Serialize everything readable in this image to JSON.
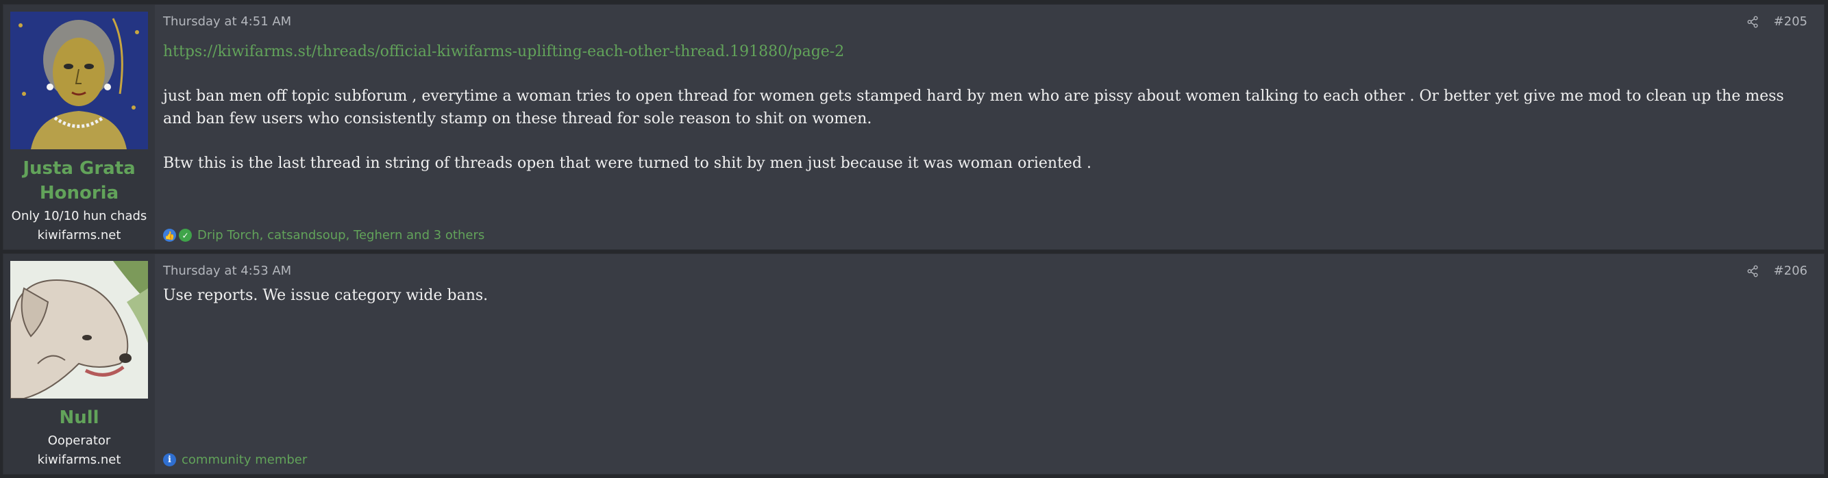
{
  "posts": [
    {
      "author": {
        "name_line1": "Justa Grata",
        "name_line2": "Honoria",
        "title": "Only 10/10 hun chads",
        "banner": "kiwifarms.net",
        "avatar_icon": "mosaic-portrait-avatar"
      },
      "date": "Thursday at 4:51 AM",
      "number": "#205",
      "link": "https://kiwifarms.st/threads/official-kiwifarms-uplifting-each-other-thread.191880/page-2",
      "paragraphs": [
        "just ban men off topic subforum , everytime a woman tries to open thread for women gets stamped hard by men who are pissy about women talking to each other . Or better yet give me mod to clean up the mess and ban few users who consistently stamp on these thread for sole reason to shit on women.",
        "Btw this is the last thread in string of threads open that were turned to shit by men just because it was woman oriented ."
      ],
      "reactions": {
        "icons": [
          "like-icon",
          "agree-icon"
        ],
        "text": "Drip Torch, catsandsoup, Teghern and 3 others"
      }
    },
    {
      "author": {
        "name": "Null",
        "title": "Ooperator",
        "banner": "kiwifarms.net",
        "avatar_icon": "dog-drawing-avatar"
      },
      "date": "Thursday at 4:53 AM",
      "number": "#206",
      "paragraphs": [
        "Use reports. We issue category wide bans."
      ],
      "reactions": {
        "icons": [
          "informative-icon"
        ],
        "text": "community member"
      }
    }
  ],
  "colors": {
    "accent_green": "#62a35a",
    "post_bg": "#393c44",
    "user_cell_bg": "#33363d",
    "page_bg": "#26282c"
  }
}
